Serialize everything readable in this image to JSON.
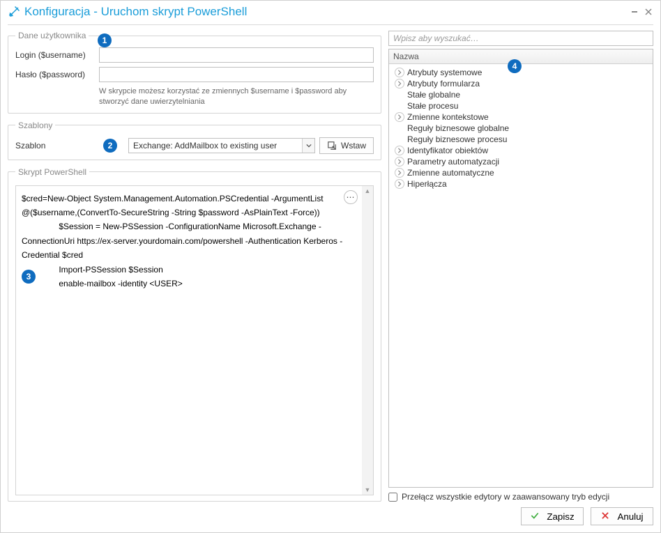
{
  "window": {
    "title": "Konfiguracja - Uruchom skrypt PowerShell"
  },
  "user_data": {
    "legend": "Dane użytkownika",
    "login_label": "Login ($username)",
    "password_label": "Hasło ($password)",
    "login_value": "",
    "password_value": "",
    "hint": "W skrypcie możesz korzystać ze zmiennych $username i $password aby stworzyć dane uwierzytelniania"
  },
  "templates": {
    "legend": "Szablony",
    "label": "Szablon",
    "selected": "Exchange: AddMailbox to existing user",
    "insert_label": "Wstaw"
  },
  "script": {
    "legend": "Skrypt PowerShell",
    "content": "$cred=New-Object System.Management.Automation.PSCredential -ArgumentList @($username,(ConvertTo-SecureString -String $password -AsPlainText -Force))\n                $Session = New-PSSession -ConfigurationName Microsoft.Exchange -ConnectionUri https://ex-server.yourdomain.com/powershell -Authentication Kerberos -Credential $cred\n                Import-PSSession $Session\n                enable-mailbox -identity <USER>"
  },
  "right": {
    "search_placeholder": "Wpisz aby wyszukać…",
    "header": "Nazwa",
    "items": [
      {
        "label": "Atrybuty systemowe",
        "expandable": true
      },
      {
        "label": "Atrybuty formularza",
        "expandable": true
      },
      {
        "label": "Stałe globalne",
        "expandable": false
      },
      {
        "label": "Stałe procesu",
        "expandable": false
      },
      {
        "label": "Zmienne kontekstowe",
        "expandable": true
      },
      {
        "label": "Reguły biznesowe globalne",
        "expandable": false
      },
      {
        "label": "Reguły biznesowe procesu",
        "expandable": false
      },
      {
        "label": "Identyfikator obiektów",
        "expandable": true
      },
      {
        "label": "Parametry automatyzacji",
        "expandable": true
      },
      {
        "label": "Zmienne automatyczne",
        "expandable": true
      },
      {
        "label": "Hiperłącza",
        "expandable": true
      }
    ],
    "checkbox_label": "Przełącz wszystkie edytory w zaawansowany tryb edycji"
  },
  "footer": {
    "save": "Zapisz",
    "cancel": "Anuluj"
  },
  "badges": {
    "b1": "1",
    "b2": "2",
    "b3": "3",
    "b4": "4"
  }
}
